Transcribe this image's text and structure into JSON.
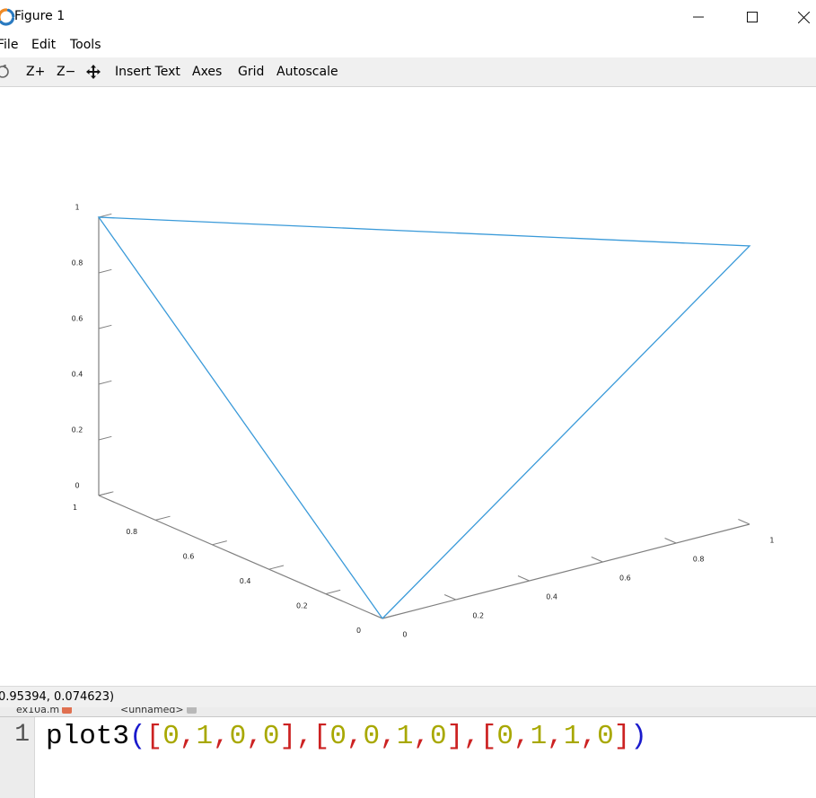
{
  "window": {
    "title": "Figure 1",
    "minimize_symbol": "—",
    "maximize_symbol": "☐",
    "close_symbol": "✕"
  },
  "menu": {
    "file": "File",
    "edit": "Edit",
    "tools": "Tools"
  },
  "toolbar": {
    "rotate_icon": "rotate-icon",
    "zoom_in": "Z+",
    "zoom_out": "Z−",
    "pan_icon": "pan-icon",
    "insert_text": "Insert Text",
    "axes": "Axes",
    "grid": "Grid",
    "autoscale": "Autoscale"
  },
  "status": {
    "coordinates": "0.95394, 0.074623)"
  },
  "editor": {
    "tabs": [
      {
        "label": "ex10a.m",
        "close_color": "#e07050"
      },
      {
        "label": "<unnamed>",
        "close_color": "#b8b8b8"
      }
    ],
    "line_number": "1",
    "code_tokens": [
      {
        "text": "plot3",
        "color": "#000000"
      },
      {
        "text": "(",
        "color": "#1a1acc"
      },
      {
        "text": "[",
        "color": "#cc2222"
      },
      {
        "text": "0",
        "color": "#a8a800"
      },
      {
        "text": ",",
        "color": "#cc2222"
      },
      {
        "text": "1",
        "color": "#a8a800"
      },
      {
        "text": ",",
        "color": "#cc2222"
      },
      {
        "text": "0",
        "color": "#a8a800"
      },
      {
        "text": ",",
        "color": "#cc2222"
      },
      {
        "text": "0",
        "color": "#a8a800"
      },
      {
        "text": "]",
        "color": "#cc2222"
      },
      {
        "text": ",",
        "color": "#cc2222"
      },
      {
        "text": "[",
        "color": "#cc2222"
      },
      {
        "text": "0",
        "color": "#a8a800"
      },
      {
        "text": ",",
        "color": "#cc2222"
      },
      {
        "text": "0",
        "color": "#a8a800"
      },
      {
        "text": ",",
        "color": "#cc2222"
      },
      {
        "text": "1",
        "color": "#a8a800"
      },
      {
        "text": ",",
        "color": "#cc2222"
      },
      {
        "text": "0",
        "color": "#a8a800"
      },
      {
        "text": "]",
        "color": "#cc2222"
      },
      {
        "text": ",",
        "color": "#cc2222"
      },
      {
        "text": "[",
        "color": "#cc2222"
      },
      {
        "text": "0",
        "color": "#a8a800"
      },
      {
        "text": ",",
        "color": "#cc2222"
      },
      {
        "text": "1",
        "color": "#a8a800"
      },
      {
        "text": ",",
        "color": "#cc2222"
      },
      {
        "text": "1",
        "color": "#a8a800"
      },
      {
        "text": ",",
        "color": "#cc2222"
      },
      {
        "text": "0",
        "color": "#a8a800"
      },
      {
        "text": "]",
        "color": "#cc2222"
      },
      {
        "text": ")",
        "color": "#1a1acc"
      }
    ]
  },
  "colors": {
    "line": "#3a9ad9",
    "axis": "#808080",
    "logo_orange": "#f08a24",
    "logo_blue": "#2a7ac0"
  },
  "chart_data": {
    "type": "line3d",
    "x": [
      0,
      1,
      0,
      0
    ],
    "y": [
      0,
      0,
      1,
      0
    ],
    "z": [
      0,
      1,
      1,
      0
    ],
    "xlim": [
      0,
      1
    ],
    "ylim": [
      0,
      1
    ],
    "zlim": [
      0,
      1
    ],
    "x_ticks": [
      "0",
      "0.2",
      "0.4",
      "0.6",
      "0.8",
      "1"
    ],
    "y_ticks": [
      "0",
      "0.2",
      "0.4",
      "0.6",
      "0.8",
      "1"
    ],
    "z_ticks": [
      "0",
      "0.2",
      "0.4",
      "0.6",
      "0.8",
      "1"
    ],
    "title": "",
    "xlabel": "",
    "ylabel": "",
    "zlabel": "",
    "grid": false,
    "line_color": "#3a9ad9"
  }
}
